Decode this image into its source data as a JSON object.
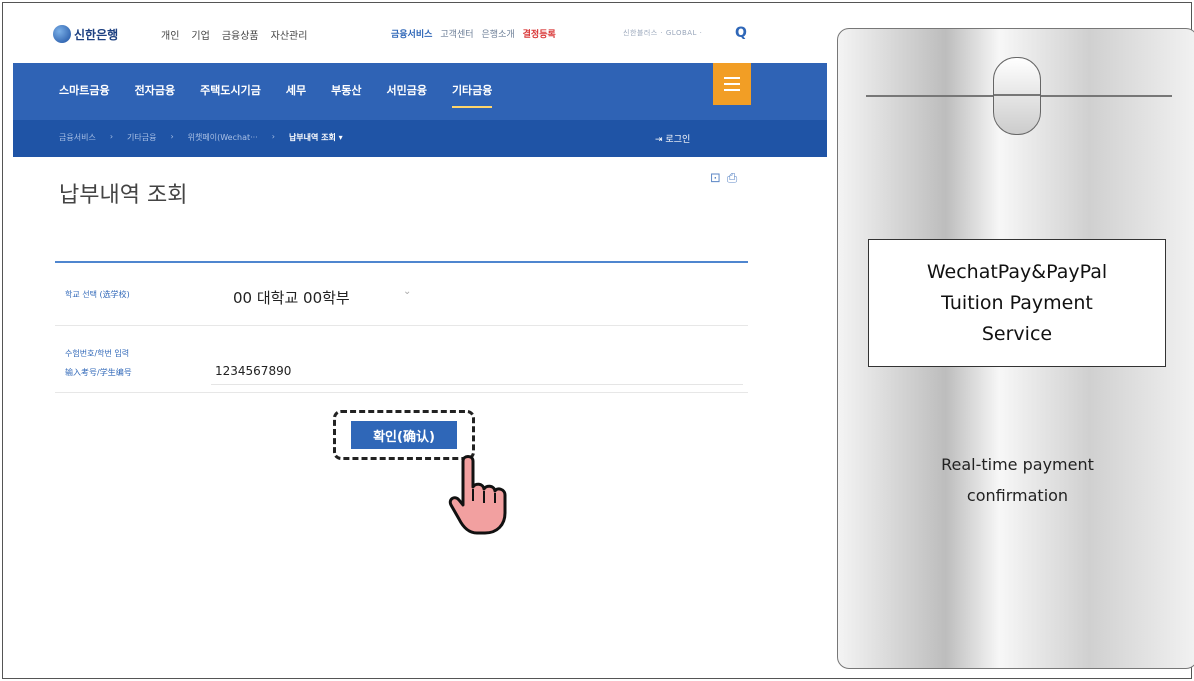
{
  "header": {
    "logo": "신한은행",
    "top_nav": [
      "개인",
      "기업",
      "금융상품",
      "자산관리"
    ],
    "service_links": [
      "금융서비스",
      "고객센터",
      "은행소개",
      "결정등록"
    ],
    "lang": "신한블러스 · GLOBAL ·"
  },
  "main_nav": [
    "스마트금융",
    "전자금융",
    "주택도시기금",
    "세무",
    "부동산",
    "서민금융",
    "기타금융"
  ],
  "breadcrumb": {
    "items": [
      "금융서비스",
      "기타금융",
      "위챗페이(Wechat···"
    ],
    "current": "납부내역 조회 ▾",
    "login": "로그인"
  },
  "page": {
    "title": "납부내역 조회",
    "tools": "⊡ ⎙"
  },
  "form": {
    "school_label": "학교 선택 (选学校)",
    "school_value": "00 대학교 00학부",
    "id_label_1": "수험번호/학번 입력",
    "id_label_2": "输入考号/学生编号",
    "id_value": "1234567890"
  },
  "confirm_button": "확인(确认)",
  "right_panel": {
    "title_lines": [
      "WechatPay&PayPal",
      "Tuition  Payment",
      "Service"
    ],
    "desc_lines": [
      "Real-time payment",
      "confirmation"
    ]
  },
  "colors": {
    "nav_blue": "#2f63b5",
    "subnav_blue": "#1f54a6",
    "menu_orange": "#f29e25",
    "button_blue": "#2f67b8"
  }
}
